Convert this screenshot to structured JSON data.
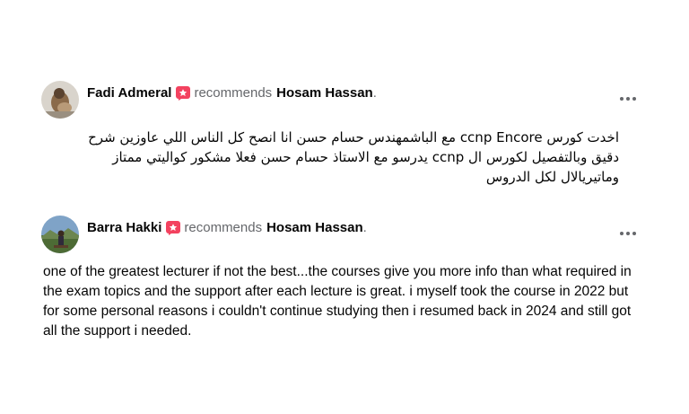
{
  "reviews": [
    {
      "author": "Fadi Admeral",
      "action": "recommends",
      "target": "Hosam Hassan",
      "punct": ".",
      "more_icon": "more-horizontal-icon",
      "body": "اخدت كورس ccnp Encore  مع الباشمهندس حسام حسن انا انصح كل الناس اللي عاوزين شرح دقيق وبالتفصيل لكورس ال ccnp يدرسو مع الاستاذ حسام حسن فعلا مشكور كواليتي ممتاز وماتيريالال لكل الدروس"
    },
    {
      "author": "Barra Hakki",
      "action": "recommends",
      "target": "Hosam Hassan",
      "punct": ".",
      "more_icon": "more-horizontal-icon",
      "body": "one of the greatest lecturer if not the best...the courses give you more info than what required in the exam topics and the support after each lecture is great. i myself took the course in 2022 but for some personal reasons i couldn't continue studying then i resumed back in 2024 and still got all the support i needed."
    }
  ],
  "colors": {
    "recommend_icon": "#f3425f",
    "secondary_text": "#65676b",
    "primary_text": "#050505"
  }
}
